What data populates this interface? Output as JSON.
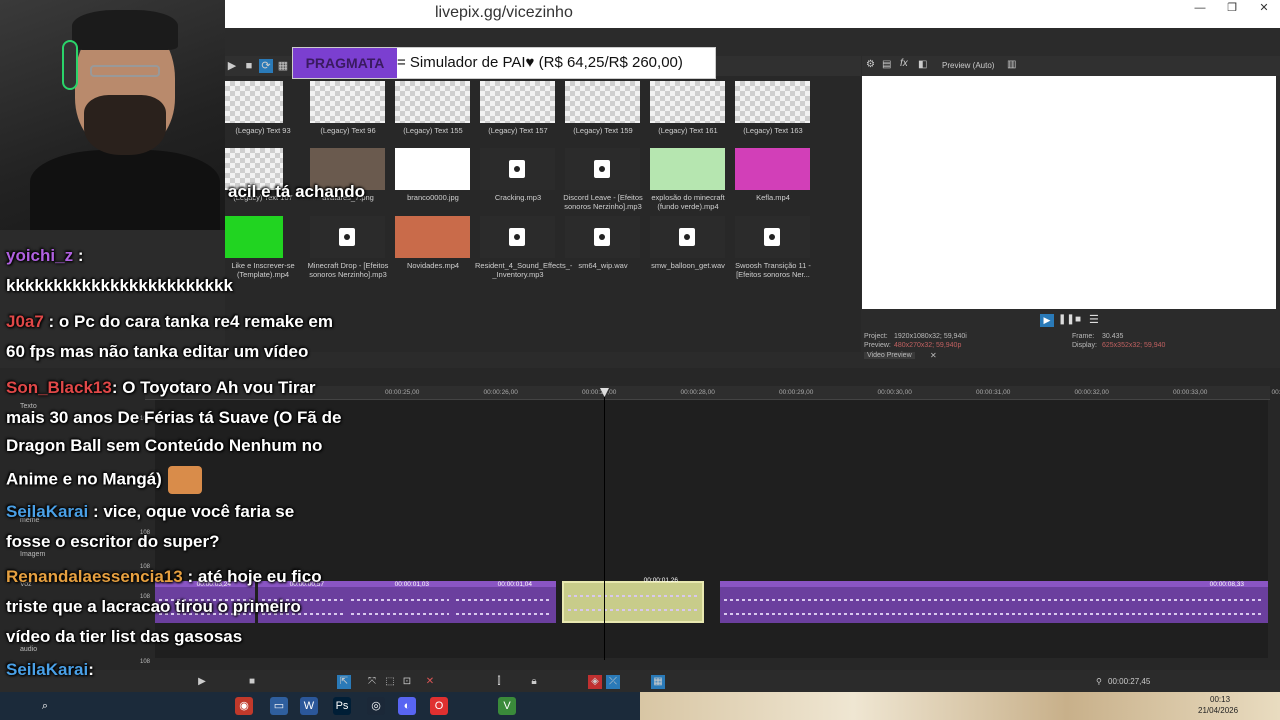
{
  "window": {
    "url_text": "livepix.gg/vicezinho",
    "minimize": "—",
    "maximize": "❐",
    "close": "✕"
  },
  "donation": {
    "tag": "PRAGMATA",
    "message": "= Simulador de PAI♥ (R$ 64,25/R$ 260,00)"
  },
  "explorer": {
    "items": [
      {
        "caption": "(Legacy) Text 93",
        "kind": "checker"
      },
      {
        "caption": "(Legacy) Text 96",
        "kind": "checker"
      },
      {
        "caption": "(Legacy) Text 155",
        "kind": "checker"
      },
      {
        "caption": "(Legacy) Text 157",
        "kind": "checker"
      },
      {
        "caption": "(Legacy) Text 159",
        "kind": "checker"
      },
      {
        "caption": "(Legacy) Text 161",
        "kind": "checker"
      },
      {
        "caption": "(Legacy) Text 163",
        "kind": "checker"
      },
      {
        "caption": "(Legacy) Text 167",
        "kind": "checker"
      },
      {
        "caption": "avatares_7.png",
        "kind": "person"
      },
      {
        "caption": "branco0000.jpg",
        "kind": "white"
      },
      {
        "caption": "Cracking.mp3",
        "kind": "doc"
      },
      {
        "caption": "Discord Leave - [Efeitos sonoros Nerzinho].mp3",
        "kind": "doc"
      },
      {
        "caption": "explosão do minecraft (fundo verde).mp4",
        "kind": "smoke"
      },
      {
        "caption": "Kefla.mp4",
        "kind": "pink"
      },
      {
        "caption": "Like e Inscrever-se (Template).mp4",
        "kind": "green"
      },
      {
        "caption": "Minecraft Drop - [Efeitos sonoros Nerzinho].mp3",
        "kind": "doc"
      },
      {
        "caption": "Novidades.mp4",
        "kind": "cartoon"
      },
      {
        "caption": "Resident_4_Sound_Effects_-_Inventory.mp3",
        "kind": "doc"
      },
      {
        "caption": "sm64_wip.wav",
        "kind": "doc"
      },
      {
        "caption": "smw_balloon_get.wav",
        "kind": "doc"
      },
      {
        "caption": "Swoosh Transição 11 - [Efeitos sonoros Ner...",
        "kind": "doc"
      }
    ]
  },
  "preview": {
    "mode_label": "Preview (Auto)",
    "project_label": "Project:",
    "project_value": "1920x1080x32; 59,940i",
    "preview_label": "Preview:",
    "preview_value": "480x270x32; 59,940p",
    "frame_label": "Frame:",
    "frame_value": "30.435",
    "display_label": "Display:",
    "display_value": "625x352x32; 59,940",
    "tab_label": "Video Preview"
  },
  "timeline": {
    "ruler": [
      "00:00:25,00",
      "00:00:26,00",
      "00:00:27,00",
      "00:00:28,00",
      "00:00:29,00",
      "00:00:30,00",
      "00:00:31,00",
      "00:00:32,00",
      "00:00:33,00",
      "00:00:34,00"
    ],
    "tracks": [
      {
        "name": "Texto"
      },
      {
        "name": "meme"
      },
      {
        "name": "Imagem"
      },
      {
        "name": "Voz"
      },
      {
        "name": "audio"
      }
    ],
    "clips": [
      {
        "label": "00:00:03,24"
      },
      {
        "label": "00:00:00,57"
      },
      {
        "label": "00:00:01,03"
      },
      {
        "label": "00:00:01,04"
      },
      {
        "label": "00:00:01,26"
      },
      {
        "label": "00:00:08,33"
      }
    ],
    "cursor_time": "00:00:27,45",
    "track_level": "108"
  },
  "chat": [
    {
      "user": "",
      "user_color": "#ffffff",
      "text": "acil e tá achando"
    },
    {
      "user": "yoichi_z",
      "user_color": "#b061e0",
      "text": " :"
    },
    {
      "user": "",
      "user_color": "#ffffff",
      "text": "kkkkkkkkkkkkkkkkkkkkkkkk"
    },
    {
      "user": "J0a7",
      "user_color": "#e04848",
      "text": " : o Pc do cara tanka re4 remake em"
    },
    {
      "user": "",
      "user_color": "#ffffff",
      "text": "60 fps mas não tanka editar um vídeo"
    },
    {
      "user": "Son_Black13",
      "user_color": "#e04848",
      "text": ": O Toyotaro Ah vou Tirar"
    },
    {
      "user": "",
      "user_color": "#ffffff",
      "text": "mais 30 anos De Férias tá Suave (O Fã de"
    },
    {
      "user": "",
      "user_color": "#ffffff",
      "text": "Dragon Ball sem Conteúdo Nenhum no"
    },
    {
      "user": "",
      "user_color": "#ffffff",
      "text": "Anime e no Mangá)"
    },
    {
      "user": "SeilaKarai",
      "user_color": "#4aa0e6",
      "text": " : vice, oque você faria se"
    },
    {
      "user": "",
      "user_color": "#ffffff",
      "text": "fosse o escritor do super?"
    },
    {
      "user": "Renandalaessencia13",
      "user_color": "#e6a040",
      "text": " : até hoje eu fico"
    },
    {
      "user": "",
      "user_color": "#ffffff",
      "text": "triste que a lacracao tirou o primeiro"
    },
    {
      "user": "",
      "user_color": "#ffffff",
      "text": "vídeo da tier list das gasosas"
    },
    {
      "user": "SeilaKarai",
      "user_color": "#4aa0e6",
      "text": ":"
    }
  ],
  "taskbar": {
    "clock_time": "00:13",
    "clock_date": "21/04/2026"
  }
}
